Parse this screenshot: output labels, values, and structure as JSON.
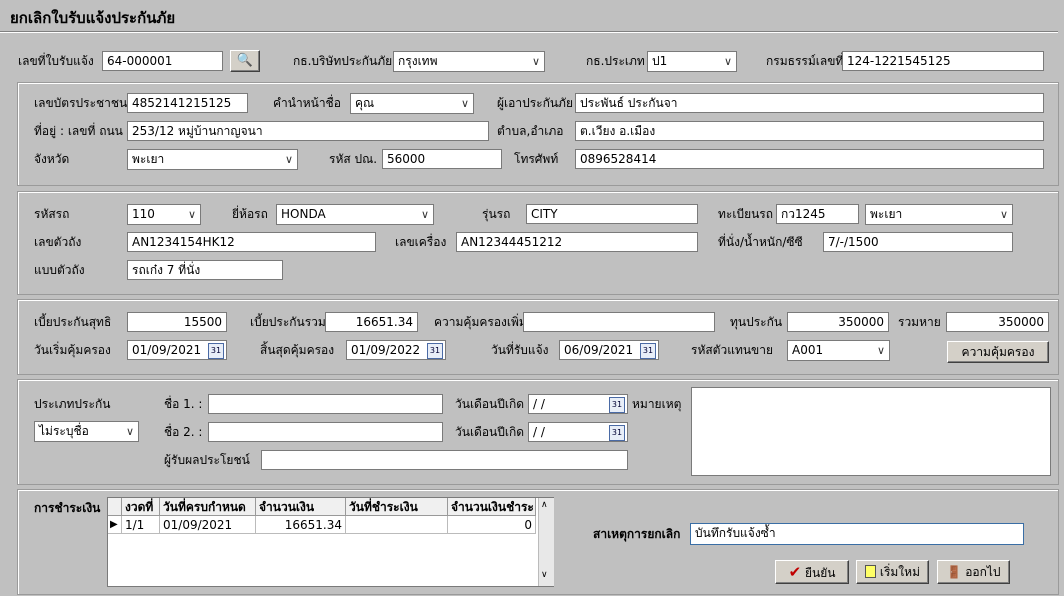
{
  "title": "ยกเลิกใบรับแจ้งประกันภัย",
  "header": {
    "receipt_no_label": "เลขที่ใบรับแจ้ง",
    "receipt_no": "64-000001",
    "insurer_label": "กธ.บริษัทประกันภัย",
    "insurer": "กรุงเทพ",
    "type_label": "กธ.ประเภท",
    "type": "ป1",
    "policy_no_label": "กรมธรรม์เลขที่",
    "policy_no": "124-1221545125"
  },
  "person": {
    "id_label": "เลขบัตรประชาชน",
    "id": "4852141215125",
    "prefix_label": "คำนำหน้าชื่อ",
    "prefix": "คุณ",
    "insured_label": "ผู้เอาประกันภัย",
    "insured": "ประพันธ์ ประกันจา",
    "address_label": "ที่อยู่ : เลขที่ ถนน",
    "address": "253/12 หมู่บ้านกาญจนา",
    "subdistrict_label": "ตำบล,อำเภอ",
    "subdistrict": "ต.เวียง อ.เมือง",
    "province_label": "จังหวัด",
    "province": "พะเยา",
    "postcode_label": "รหัส ปณ.",
    "postcode": "56000",
    "phone_label": "โทรศัพท์",
    "phone": "0896528414"
  },
  "vehicle": {
    "code_label": "รหัสรถ",
    "code": "110",
    "brand_label": "ยี่ห้อรถ",
    "brand": "HONDA",
    "model_label": "รุ่นรถ",
    "model": "CITY",
    "plate_label": "ทะเบียนรถ",
    "plate": "กว1245",
    "plate_province": "พะเยา",
    "chassis_label": "เลขตัวถัง",
    "chassis": "AN1234154HK12",
    "engine_label": "เลขเครื่อง",
    "engine": "AN12344451212",
    "seats_label": "ที่นั่ง/น้ำหนัก/ซีซี",
    "seats": "7/-/1500",
    "body_label": "แบบตัวถัง",
    "body": "รถเก๋ง 7 ที่นั่ง"
  },
  "premium": {
    "net_label": "เบี้ยประกันสุทธิ",
    "net": "15500",
    "total_label": "เบี้ยประกันรวม",
    "total": "16651.34",
    "extra_label": "ความคุ้มครองเพิ่ม",
    "extra": "",
    "sum_label": "ทุนประกัน",
    "sum": "350000",
    "loss_label": "รวมหาย",
    "loss": "350000",
    "start_label": "วันเริ่มคุ้มครอง",
    "start": "01/09/2021",
    "end_label": "สิ้นสุดคุ้มครอง",
    "end": "01/09/2022",
    "received_label": "วันที่รับแจ้ง",
    "received": "06/09/2021",
    "agent_label": "รหัสตัวแทนขาย",
    "agent": "A001",
    "coverage_button": "ความคุ้มครอง",
    "calendar_icon_text": "31"
  },
  "driver": {
    "type_label": "ประเภทประกัน",
    "type": "ไม่ระบุชื่อ",
    "name1_label": "ชื่อ 1. :",
    "name1": "",
    "dob1_label": "วันเดือนปีเกิด",
    "dob1": " /  /",
    "name2_label": "ชื่อ 2. :",
    "name2": "",
    "dob2_label": "วันเดือนปีเกิด",
    "dob2": " /  /",
    "beneficiary_label": "ผู้รับผลประโยชน์",
    "beneficiary": "",
    "note_label": "หมายเหตุ",
    "note": ""
  },
  "payment": {
    "label": "การชำระเงิน",
    "columns": [
      "งวดที่",
      "วันที่ครบกำหนด",
      "จำนวนเงิน",
      "วันที่ชำระเงิน",
      "จำนวนเงินชำระ"
    ],
    "rows": [
      [
        "1/1",
        "01/09/2021",
        "16651.34",
        "",
        "0"
      ]
    ],
    "row_pointer": "▶"
  },
  "cancel": {
    "reason_label": "สาเหตุการยกเลิก",
    "reason": "บันทึกรับแจ้งซ้ำ",
    "confirm": "ยืนยัน",
    "new": "เริ่มใหม่",
    "exit": "ออกไป"
  }
}
